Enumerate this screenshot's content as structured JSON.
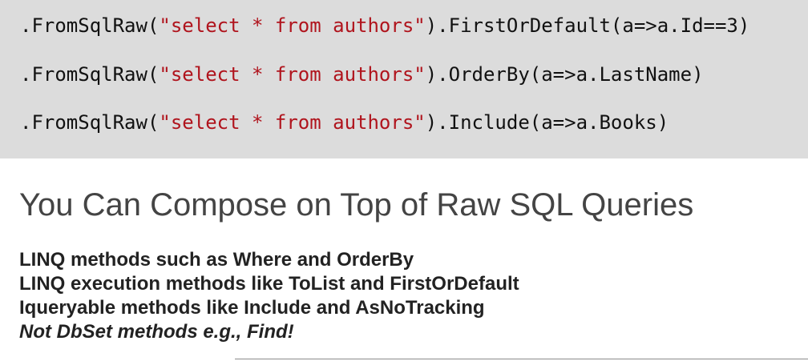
{
  "code": {
    "lines": [
      {
        "prefix": ".FromSqlRaw(",
        "string": "\"select * from authors\"",
        "suffix": ").FirstOrDefault(a=>a.Id==3)"
      },
      {
        "prefix": ".FromSqlRaw(",
        "string": "\"select * from authors\"",
        "suffix": ").OrderBy(a=>a.LastName)"
      },
      {
        "prefix": ".FromSqlRaw(",
        "string": "\"select * from authors\"",
        "suffix": ").Include(a=>a.Books)"
      }
    ]
  },
  "slide": {
    "title": "You Can Compose on Top of Raw SQL Queries",
    "bullets": [
      "LINQ methods such as Where and OrderBy",
      "LINQ execution methods like ToList and FirstOrDefault",
      "Iqueryable methods like Include and AsNoTracking",
      "Not DbSet methods e.g., Find!"
    ]
  },
  "colors": {
    "code_background": "#dcdcdc",
    "string_literal": "#b0141d",
    "title_text": "#444444",
    "bullet_text": "#222222"
  }
}
